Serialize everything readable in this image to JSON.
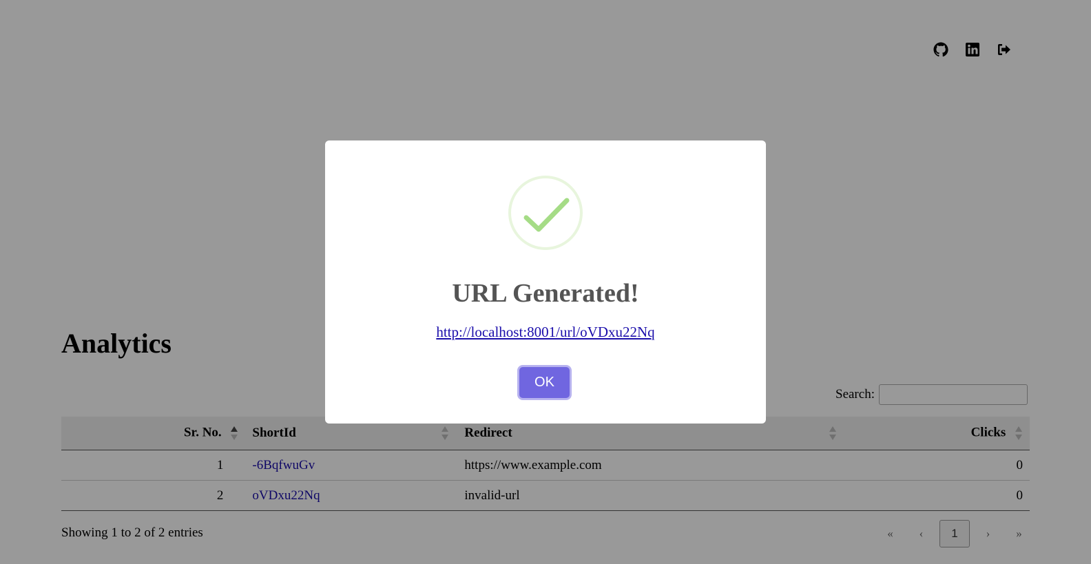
{
  "header": {
    "icons": [
      "github-icon",
      "linkedin-icon",
      "logout-icon"
    ]
  },
  "analytics": {
    "title": "Analytics",
    "search_label": "Search:",
    "search_value": "",
    "columns": [
      "Sr. No.",
      "ShortId",
      "Redirect",
      "Clicks"
    ],
    "rows": [
      {
        "sr": "1",
        "short_id": "-6BqfwuGv",
        "redirect": "https://www.example.com",
        "clicks": "0"
      },
      {
        "sr": "2",
        "short_id": "oVDxu22Nq",
        "redirect": "invalid-url",
        "clicks": "0"
      }
    ],
    "info": "Showing 1 to 2 of 2 entries",
    "pagination": {
      "first": "«",
      "prev": "‹",
      "current": "1",
      "next": "›",
      "last": "»"
    }
  },
  "modal": {
    "title": "URL Generated!",
    "link_text": "http://localhost:8001/url/oVDxu22Nq",
    "ok_label": "OK",
    "icon": "success-check-icon"
  },
  "colors": {
    "overlay": "rgba(0,0,0,0.4)",
    "ok_button": "#7066e0",
    "success_green": "#a5dc86",
    "link": "#1a0dab"
  }
}
